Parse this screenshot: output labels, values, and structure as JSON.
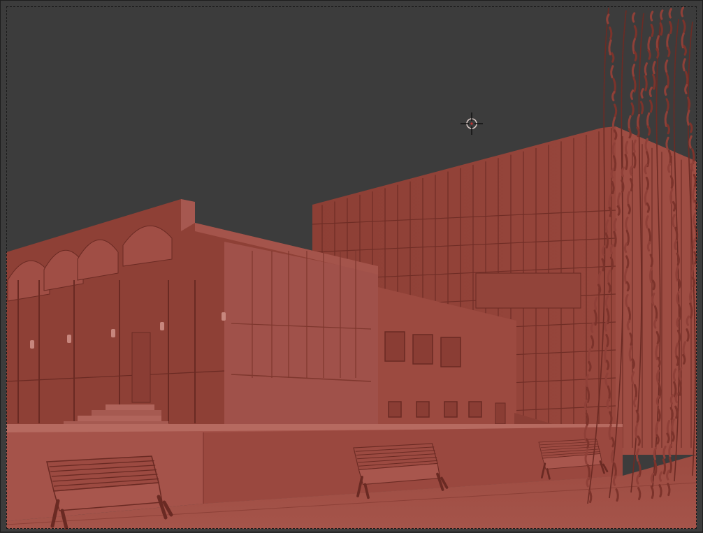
{
  "viewport": {
    "view": "perspective-viewport",
    "shading": "clay-render",
    "colors": {
      "background": "#3c3c3c",
      "clay_base": "#8a3e35",
      "clay_light": "#a4524a",
      "clay_dark": "#5e2620",
      "clay_ground": "#9a4a40"
    }
  },
  "gizmo": {
    "icon": "crosshair-target-icon"
  },
  "scene": {
    "objects": [
      "auditorium-hall",
      "annex-block",
      "tower-block",
      "plinth-wall",
      "bench",
      "bench",
      "bench",
      "willow-tree"
    ]
  }
}
